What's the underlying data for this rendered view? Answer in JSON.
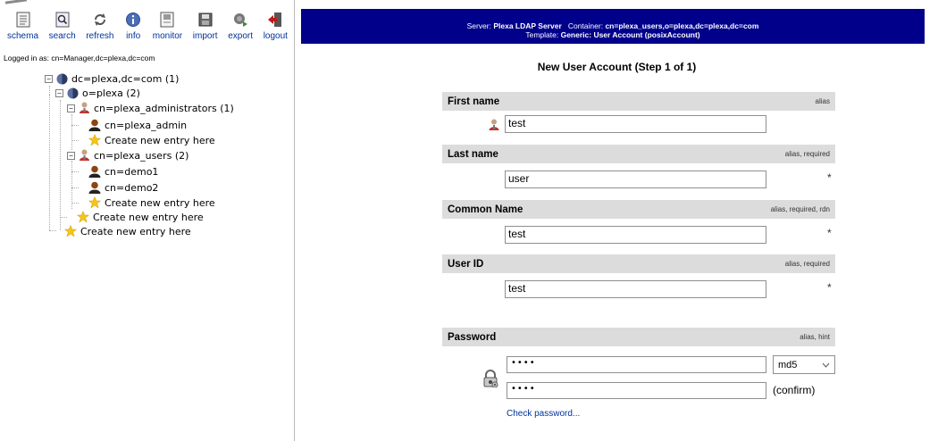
{
  "toolbar": {
    "items": [
      {
        "label": "schema",
        "icon": "schema-icon"
      },
      {
        "label": "search",
        "icon": "search-icon"
      },
      {
        "label": "refresh",
        "icon": "refresh-icon"
      },
      {
        "label": "info",
        "icon": "info-icon"
      },
      {
        "label": "monitor",
        "icon": "monitor-icon"
      },
      {
        "label": "import",
        "icon": "import-icon"
      },
      {
        "label": "export",
        "icon": "export-icon"
      },
      {
        "label": "logout",
        "icon": "logout-icon"
      }
    ]
  },
  "session": {
    "logged_in": "Logged in as: cn=Manager,dc=plexa,dc=com"
  },
  "tree": {
    "root": "dc=plexa,dc=com (1)",
    "org": "o=plexa (2)",
    "admins_group": "cn=plexa_administrators (1)",
    "admin_user": "cn=plexa_admin",
    "create_in_admins": "Create new entry here",
    "users_group": "cn=plexa_users (2)",
    "user1": "cn=demo1",
    "user2": "cn=demo2",
    "create_in_users": "Create new entry here",
    "create_in_org": "Create new entry here",
    "create_in_root": "Create new entry here"
  },
  "banner": {
    "server_label": "Server:",
    "server_value": "Plexa LDAP Server",
    "container_label": "Container:",
    "container_value": "cn=plexa_users,o=plexa,dc=plexa,dc=com",
    "template_label": "Template:",
    "template_value": "Generic: User Account (posixAccount)"
  },
  "form": {
    "title": "New User Account (Step 1 of 1)",
    "fields": [
      {
        "label": "First name",
        "hints": "alias",
        "value": "test",
        "required": ""
      },
      {
        "label": "Last name",
        "hints": "alias, required",
        "value": "user",
        "required": "*"
      },
      {
        "label": "Common Name",
        "hints": "alias, required, rdn",
        "value": "test",
        "required": "*"
      },
      {
        "label": "User ID",
        "hints": "alias, required",
        "value": "test",
        "required": "*"
      }
    ],
    "password": {
      "label": "Password",
      "hints": "alias, hint",
      "value": "••••",
      "confirm_value": "••••",
      "hash": "md5",
      "confirm_label": "(confirm)",
      "check_link": "Check password..."
    }
  },
  "colors": {
    "banner": "#00008b",
    "link": "#003399",
    "field_header": "#dcdcdc"
  }
}
